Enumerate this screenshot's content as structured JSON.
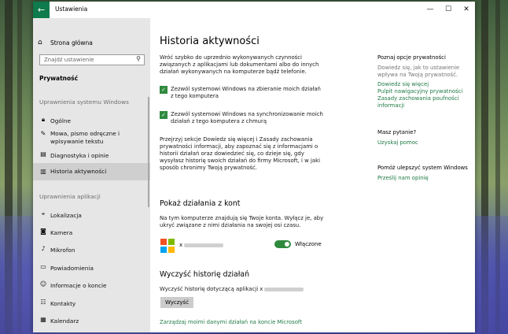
{
  "window": {
    "title": "Ustawienia",
    "back_icon": "arrow-left-icon",
    "minimize": "—",
    "maximize": "☐",
    "close": "✕"
  },
  "sidebar": {
    "home_label": "Strona główna",
    "search_placeholder": "Znajdź ustawienie",
    "current_section": "Prywatność",
    "section_windows": "Uprawnienia systemu Windows",
    "windows_items": [
      {
        "label": "Ogólne",
        "icon": "lock-icon"
      },
      {
        "label": "Mowa, pismo odręczne i wpisywanie tekstu",
        "icon": "pen-icon"
      },
      {
        "label": "Diagnostyka i opinie",
        "icon": "feedback-icon"
      },
      {
        "label": "Historia aktywności",
        "icon": "history-icon",
        "active": true
      }
    ],
    "section_apps": "Uprawnienia aplikacji",
    "app_items": [
      {
        "label": "Lokalizacja",
        "icon": "location-icon"
      },
      {
        "label": "Kamera",
        "icon": "camera-icon"
      },
      {
        "label": "Mikrofon",
        "icon": "microphone-icon"
      },
      {
        "label": "Powiadomienia",
        "icon": "notifications-icon"
      },
      {
        "label": "Informacje o koncie",
        "icon": "account-info-icon"
      },
      {
        "label": "Kontakty",
        "icon": "contacts-icon"
      },
      {
        "label": "Kalendarz",
        "icon": "calendar-icon"
      }
    ]
  },
  "main": {
    "title": "Historia aktywności",
    "intro": "Wróć szybko do uprzednio wykonywanych czynności związanych z aplikacjami lub dokumentami albo do innych działań wykonywanych na komputerze bądź telefonie.",
    "checkbox1": "Zezwól systemowi Windows na zbieranie moich działań z tego komputera",
    "checkbox2": "Zezwól systemowi Windows na synchronizowanie moich działań z tego komputera z chmurą",
    "privacy_note": "Przejrzyj sekcje Dowiedz się więcej i Zasady zachowania prywatności informacji, aby zapoznać się z informacjami o historii działań oraz dowiedzieć się, co dzieje się, gdy wysyłasz historię swoich działań do firmy Microsoft, i w jaki sposób chronimy Twoją prywatność.",
    "show_heading": "Pokaż działania z kont",
    "show_desc": "Na tym komputerze znajdują się Twoje konta. Wyłącz je, aby ukryć związane z nimi działania na swojej osi czasu.",
    "account_prefix": "x",
    "toggle_label": "Włączone",
    "clear_heading": "Wyczyść historię działań",
    "clear_desc": "Wyczyść historię dotyczącą aplikacji x",
    "clear_button": "Wyczyść",
    "manage_link": "Zarządzaj moimi danymi działań na koncie Microsoft"
  },
  "right_panel": {
    "privacy_heading": "Poznaj opcje prywatności",
    "privacy_text": "Dowiedz się, jak to ustawienie wpływa na Twoją prywatność.",
    "links": [
      "Dowiedz się więcej",
      "Pulpit nawigacyjny prywatności",
      "Zasady zachowania poufności informacji"
    ],
    "question_heading": "Masz pytanie?",
    "help_link": "Uzyskaj pomoc",
    "improve_heading": "Pomóż ulepszyć system Windows",
    "feedback_link": "Prześlij nam opinię"
  }
}
